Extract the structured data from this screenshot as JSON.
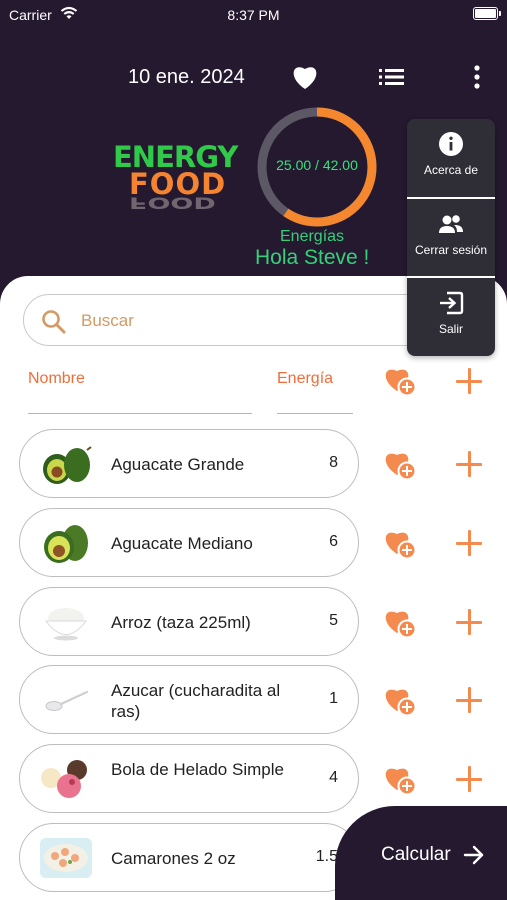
{
  "status_bar": {
    "carrier": "Carrier",
    "time": "8:37 PM"
  },
  "header": {
    "date": "10 ene. 2024"
  },
  "logo": {
    "line1": "ENERGY",
    "line2": "FOOD"
  },
  "progress": {
    "label": "25.00 / 42.00",
    "consumed": 25.0,
    "total": 42.0,
    "caption": "Energías",
    "greeting": "Hola Steve !"
  },
  "menu": {
    "items": [
      {
        "label": "Acerca de",
        "icon": "info-icon"
      },
      {
        "label": "Cerrar sesión",
        "icon": "users-icon"
      },
      {
        "label": "Salir",
        "icon": "exit-icon"
      }
    ]
  },
  "search": {
    "placeholder": "Buscar"
  },
  "columns": {
    "name": "Nombre",
    "energy": "Energía"
  },
  "foods": [
    {
      "name": "Aguacate Grande",
      "energy": "8"
    },
    {
      "name": "Aguacate Mediano",
      "energy": "6"
    },
    {
      "name": "Arroz (taza 225ml)",
      "energy": "5"
    },
    {
      "name": "Azucar (cucharadita al ras)",
      "energy": "1"
    },
    {
      "name": "Bola de Helado Simple",
      "energy": "4"
    },
    {
      "name": "Camarones 2 oz",
      "energy": "1.5"
    }
  ],
  "footer": {
    "calculate_label": "Calcular"
  },
  "colors": {
    "dark_bg": "#24192f",
    "accent_orange": "#f58a4e",
    "accent_green": "#34d17a"
  }
}
